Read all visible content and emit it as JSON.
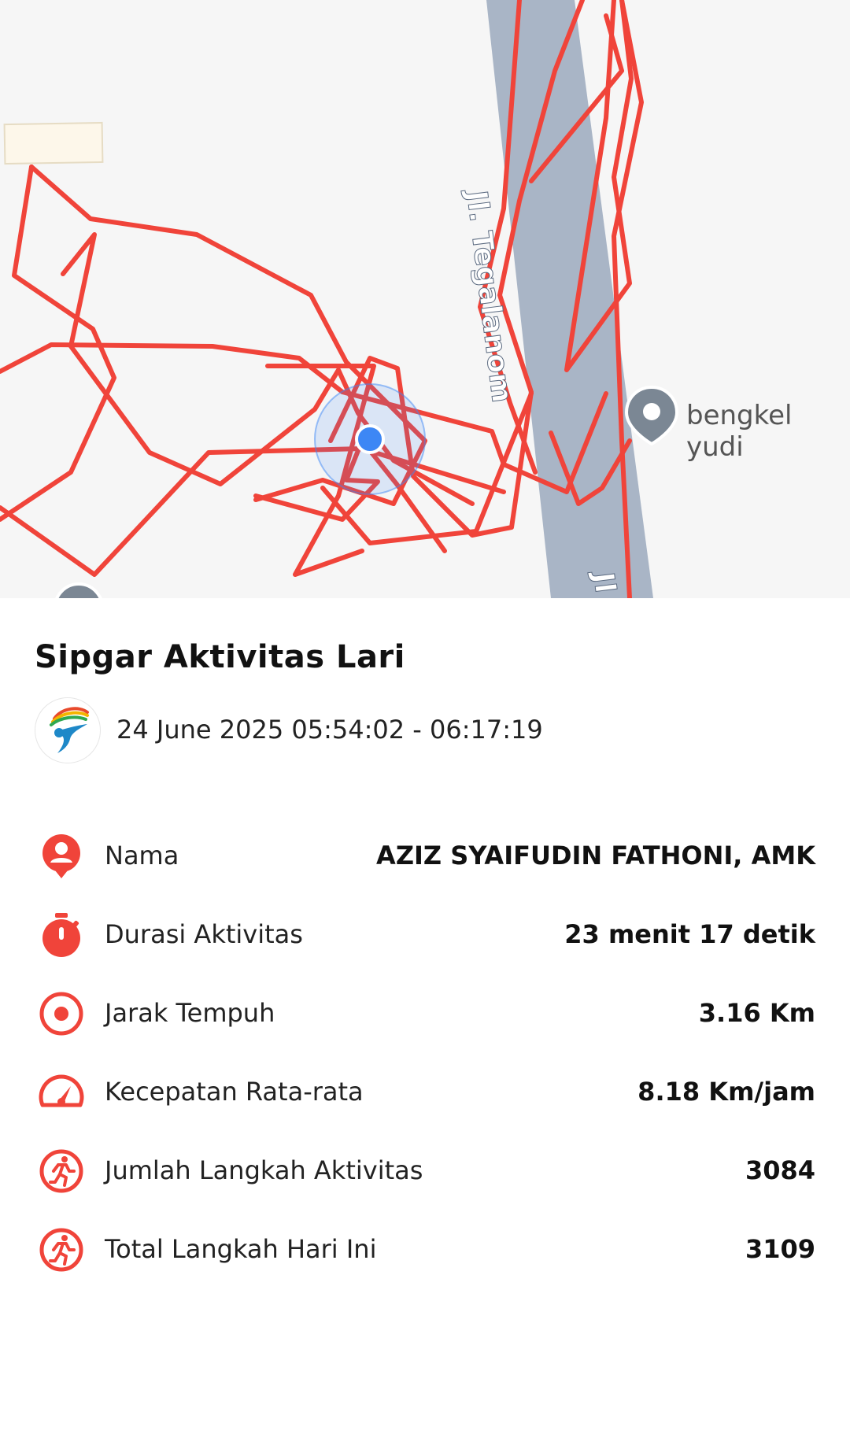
{
  "map": {
    "street_name": "Jl. Tegalanom",
    "street_name_partial": "Jl",
    "poi_label": "bengkel yudi",
    "colors": {
      "route": "#f0443a",
      "road": "#a9b5c6",
      "location": "#3d87f5",
      "background": "#f6f6f6"
    }
  },
  "activity": {
    "title": "Sipgar Aktivitas Lari",
    "datetime": "24 June 2025 05:54:02 - 06:17:19",
    "rows": [
      {
        "icon": "person-icon",
        "label": "Nama",
        "value": "AZIZ SYAIFUDIN FATHONI, AMK"
      },
      {
        "icon": "stopwatch-icon",
        "label": "Durasi Aktivitas",
        "value": "23 menit 17 detik"
      },
      {
        "icon": "target-icon",
        "label": "Jarak Tempuh",
        "value": "3.16 Km"
      },
      {
        "icon": "speedometer-icon",
        "label": "Kecepatan Rata-rata",
        "value": "8.18 Km/jam"
      },
      {
        "icon": "runner-icon",
        "label": "Jumlah Langkah Aktivitas",
        "value": "3084"
      },
      {
        "icon": "runner-icon",
        "label": "Total Langkah Hari Ini",
        "value": "3109"
      }
    ],
    "accent_color": "#f0443a"
  }
}
